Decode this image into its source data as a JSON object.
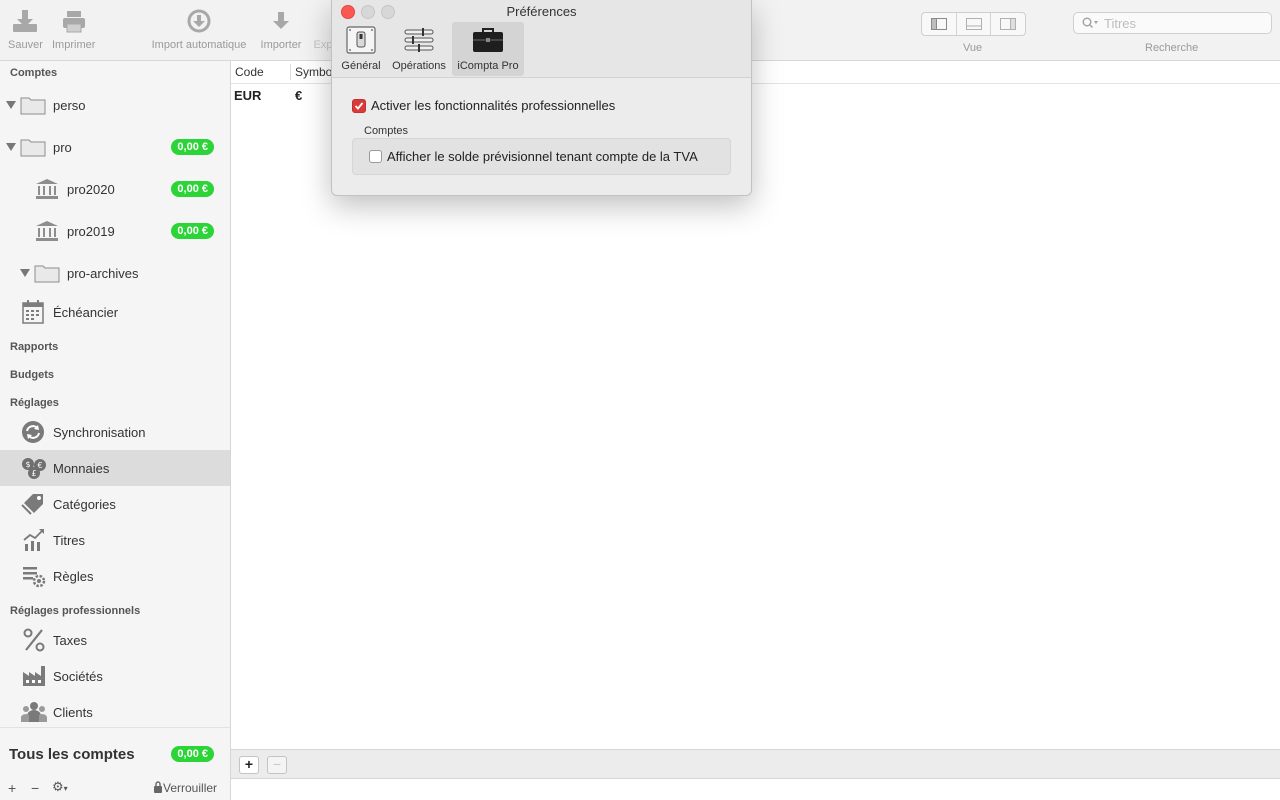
{
  "toolbar": {
    "save": "Sauver",
    "print": "Imprimer",
    "auto_import": "Import automatique",
    "import": "Importer",
    "export_partial": "Exp",
    "view_label": "Vue",
    "search_label": "Recherche",
    "search_placeholder": "Titres"
  },
  "sidebar": {
    "sections": {
      "accounts": "Comptes",
      "reports": "Rapports",
      "budgets": "Budgets",
      "settings": "Réglages",
      "pro_settings": "Réglages professionnels"
    },
    "accounts": [
      {
        "label": "perso"
      },
      {
        "label": "pro",
        "balance": "0,00 €"
      },
      {
        "label": "pro2020",
        "balance": "0,00 €"
      },
      {
        "label": "pro2019",
        "balance": "0,00 €"
      },
      {
        "label": "pro-archives"
      },
      {
        "label": "Échéancier"
      }
    ],
    "settings": [
      "Synchronisation",
      "Monnaies",
      "Catégories",
      "Titres",
      "Règles"
    ],
    "pro_settings": [
      "Taxes",
      "Sociétés",
      "Clients"
    ],
    "total_label": "Tous les comptes",
    "total_balance": "0,00 €",
    "footer": {
      "add": "+",
      "remove": "−",
      "gear": "⚙",
      "lock": "Verrouiller"
    }
  },
  "table": {
    "headers": [
      "Code",
      "Symbo"
    ],
    "rows": [
      {
        "code": "EUR",
        "symbol": "€"
      }
    ]
  },
  "bottom": {
    "add": "+",
    "remove": "−"
  },
  "preferences": {
    "title": "Préférences",
    "tabs": [
      "Général",
      "Opérations",
      "iCompta Pro"
    ],
    "enable_pro": "Activer les fonctionnalités professionnelles",
    "group_label": "Comptes",
    "vat_option": "Afficher le solde prévisionnel tenant compte de la TVA"
  },
  "colors": {
    "accent_green": "#2bd437",
    "checkbox_red": "#d93a3a",
    "close_red": "#fc5753"
  }
}
